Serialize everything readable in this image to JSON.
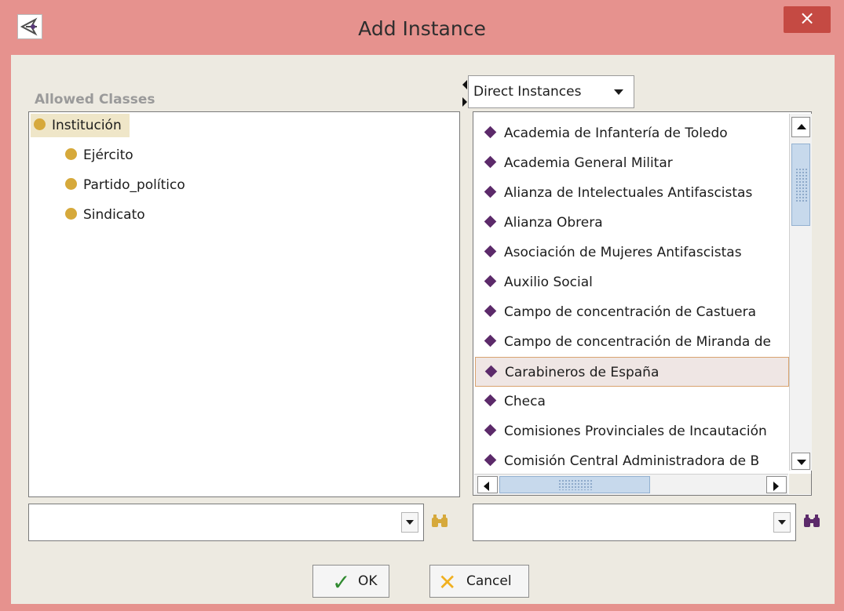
{
  "window": {
    "title": "Add Instance",
    "close_glyph": "×",
    "app_icon": "protege-icon"
  },
  "left": {
    "label": "Allowed Classes",
    "tree": [
      {
        "label": "Institución",
        "level": 0,
        "selected": true
      },
      {
        "label": "Ejército",
        "level": 1
      },
      {
        "label": "Partido_político",
        "level": 1
      },
      {
        "label": "Sindicato",
        "level": 1
      }
    ],
    "search": {
      "value": "",
      "icon": "binoculars-icon"
    }
  },
  "right": {
    "view_selector": "Direct Instances",
    "instances": [
      "Academia de Infantería de Toledo",
      "Academia General Militar",
      "Alianza de Intelectuales Antifascistas",
      "Alianza Obrera",
      "Asociación de Mujeres Antifascistas",
      "Auxilio Social",
      "Campo de concentración de Castuera",
      "Campo de concentración de Miranda de",
      "Carabineros de España",
      "Checa",
      "Comisiones Provinciales de Incautación",
      "Comisión Central Administradora de B"
    ],
    "selected_index": 8,
    "search": {
      "value": "",
      "icon": "binoculars-icon"
    }
  },
  "buttons": {
    "ok": {
      "label": "OK",
      "icon": "checkmark-icon",
      "icon_glyph": "✓"
    },
    "cancel": {
      "label": "Cancel",
      "icon": "x-mark-icon",
      "icon_glyph": "✕"
    }
  },
  "colors": {
    "titlebar": "#e6928e",
    "close_button": "#c54a43",
    "class_dot": "#d6a93b",
    "instance_diamond": "#5c2a6a",
    "dialog_bg": "#edeae1"
  }
}
